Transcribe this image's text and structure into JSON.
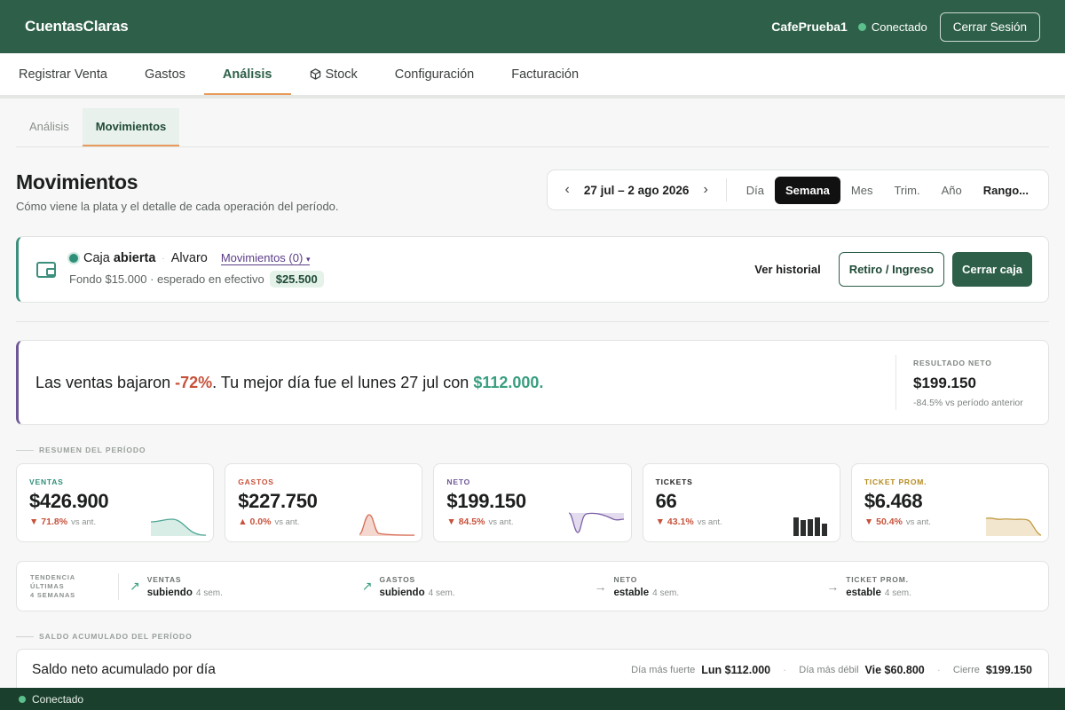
{
  "header": {
    "brand": "CuentasClaras",
    "user": "CafePrueba1",
    "status": "Conectado",
    "logout": "Cerrar Sesión"
  },
  "nav": {
    "tabs": [
      {
        "label": "Registrar Venta"
      },
      {
        "label": "Gastos"
      },
      {
        "label": "Análisis"
      },
      {
        "label": "Stock"
      },
      {
        "label": "Configuración"
      },
      {
        "label": "Facturación"
      }
    ],
    "active": "Análisis"
  },
  "subnav": {
    "tabs": [
      {
        "label": "Análisis"
      },
      {
        "label": "Movimientos"
      }
    ],
    "active": "Movimientos"
  },
  "page": {
    "title": "Movimientos",
    "subtitle": "Cómo viene la plata y el detalle de cada operación del período."
  },
  "period": {
    "range": "27 jul – 2 ago 2026",
    "prev": "‹",
    "next": "›",
    "options": [
      "Día",
      "Semana",
      "Mes",
      "Trim.",
      "Año",
      "Rango..."
    ],
    "active": "Semana"
  },
  "caja": {
    "label": "Caja",
    "state": "abierta",
    "separator": "·",
    "cashier": "Alvaro",
    "movements": "Movimientos (0)",
    "caret": "▾",
    "fund": "Fondo $15.000 · esperado en efectivo",
    "expected": "$25.500",
    "history": "Ver historial",
    "withdraw": "Retiro / Ingreso",
    "close": "Cerrar caja"
  },
  "insight": {
    "pre": "Las ventas bajaron ",
    "pct": "-72%",
    "mid": ". Tu mejor día fue el lunes 27 jul con ",
    "amount": "$112.000.",
    "net_label": "RESULTADO NETO",
    "net_value": "$199.150",
    "net_sub": "-84.5% vs período anterior"
  },
  "summary": {
    "section": "RESUMEN DEL PERÍODO",
    "vs": "vs ant.",
    "cards": [
      {
        "label": "VENTAS",
        "value": "$426.900",
        "delta": "▼ 71.8%",
        "color": "#2e8f78",
        "delta_color": "#c7523b"
      },
      {
        "label": "GASTOS",
        "value": "$227.750",
        "delta": "▲ 0.0%",
        "color": "#c7523b",
        "delta_color": "#c7523b"
      },
      {
        "label": "NETO",
        "value": "$199.150",
        "delta": "▼ 84.5%",
        "color": "#6e5796",
        "delta_color": "#c7523b"
      },
      {
        "label": "TICKETS",
        "value": "66",
        "delta": "▼ 43.1%",
        "color": "#1c1f1d",
        "delta_color": "#c7523b"
      },
      {
        "label": "TICKET PROM.",
        "value": "$6.468",
        "delta": "▼ 50.4%",
        "color": "#b58a1d",
        "delta_color": "#c7523b"
      }
    ]
  },
  "trend": {
    "head": [
      "TENDENCIA",
      "ÚLTIMAS",
      "4 SEMANAS"
    ],
    "items": [
      {
        "label": "VENTAS",
        "value": "subiendo",
        "period": "4 sem.",
        "icon": "↗"
      },
      {
        "label": "GASTOS",
        "value": "subiendo",
        "period": "4 sem.",
        "icon": "↗"
      },
      {
        "label": "NETO",
        "value": "estable",
        "period": "4 sem.",
        "icon": "→"
      },
      {
        "label": "TICKET PROM.",
        "value": "estable",
        "period": "4 sem.",
        "icon": "→"
      }
    ]
  },
  "saldo": {
    "section": "SALDO ACUMULADO DEL PERÍODO",
    "title": "Saldo neto acumulado por día",
    "strong_label": "Día más fuerte",
    "strong_value": "Lun $112.000",
    "weak_label": "Día más débil",
    "weak_value": "Vie $60.800",
    "close_label": "Cierre",
    "close_value": "$199.150"
  },
  "statusbar": {
    "text": "Conectado"
  }
}
